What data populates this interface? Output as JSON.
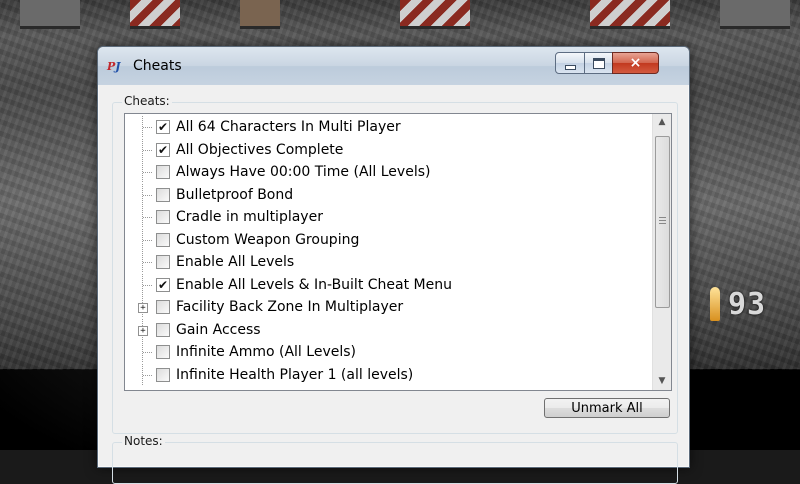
{
  "window": {
    "title": "Cheats",
    "icon": "pj64-icon",
    "controls": {
      "minimize": "minimize-icon",
      "maximize": "maximize-icon",
      "close": "×"
    }
  },
  "cheats_group": {
    "label": "Cheats:",
    "items": [
      {
        "label": "All 64 Characters In Multi Player",
        "checked": true,
        "expandable": false
      },
      {
        "label": "All Objectives Complete",
        "checked": true,
        "expandable": false
      },
      {
        "label": "Always Have 00:00 Time (All Levels)",
        "checked": false,
        "expandable": false
      },
      {
        "label": "Bulletproof Bond",
        "checked": false,
        "expandable": false
      },
      {
        "label": "Cradle in multiplayer",
        "checked": false,
        "expandable": false
      },
      {
        "label": "Custom Weapon Grouping",
        "checked": false,
        "expandable": false
      },
      {
        "label": "Enable All Levels",
        "checked": false,
        "expandable": false
      },
      {
        "label": "Enable All Levels & In-Built Cheat Menu",
        "checked": true,
        "expandable": false
      },
      {
        "label": "Facility Back Zone In Multiplayer",
        "checked": false,
        "expandable": true
      },
      {
        "label": "Gain Access",
        "checked": false,
        "expandable": true
      },
      {
        "label": "Infinite Ammo (All Levels)",
        "checked": false,
        "expandable": false
      },
      {
        "label": "Infinite Health Player 1 (all levels)",
        "checked": false,
        "expandable": false
      }
    ],
    "unmark_all_label": "Unmark All"
  },
  "notes_group": {
    "label": "Notes:"
  },
  "hud": {
    "ammo_count": "93"
  },
  "colors": {
    "close_button": "#c2391f",
    "title_bar": "#c9d5e2"
  }
}
